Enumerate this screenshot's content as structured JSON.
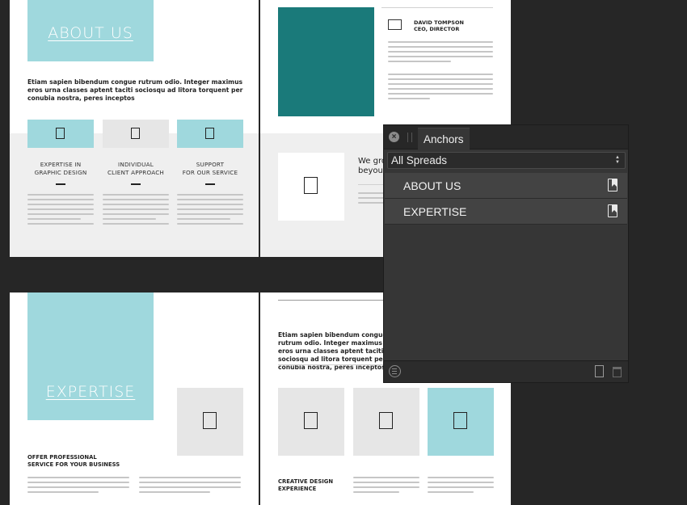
{
  "spread_top": {
    "about_heading": "ABOUT US",
    "intro_text": "Etiam sapien bibendum congue rutrum odio. Integer maximus eros urna classes aptent taciti sociosqu ad litora torquent per conubia nostra, peres inceptos",
    "features": [
      {
        "caption": "EXPERTISE IN\nGRAPHIC DESIGN"
      },
      {
        "caption": "INDIVIDUAL\nCLIENT APPROACH"
      },
      {
        "caption": "SUPPORT\nFOR OUR SERVICE"
      }
    ],
    "ceo_name": "DAVID TOMPSON",
    "ceo_title": "CEO, DIRECTOR",
    "partial_heading": "We gro\nbeyour"
  },
  "spread_bottom": {
    "expertise_heading": "EXPERTISE",
    "intro_text": "Etiam sapien bibendum congue rutrum odio. Integer maximus eros urna classes aptent taciti sociosqu ad litora torquent per conubia nostra, peres inceptos",
    "service_heading": "OFFER PROFESSIONAL\nSERVICE FOR YOUR BUSINESS",
    "creative_heading": "CREATIVE DESIGN\nEXPERIENCE"
  },
  "anchors_panel": {
    "tab_label": "Anchors",
    "filter_value": "All Spreads",
    "items": [
      {
        "label": "ABOUT US",
        "icon": "bookmark-icon"
      },
      {
        "label": "EXPERTISE",
        "icon": "bookmark-icon"
      }
    ],
    "footer_icons": [
      "menu-icon",
      "new-page-icon",
      "trash-icon"
    ]
  },
  "colors": {
    "teal": "#9fd8dd",
    "dark_teal": "#1a7a7a",
    "background": "#262626",
    "panel_bg": "#363636"
  }
}
